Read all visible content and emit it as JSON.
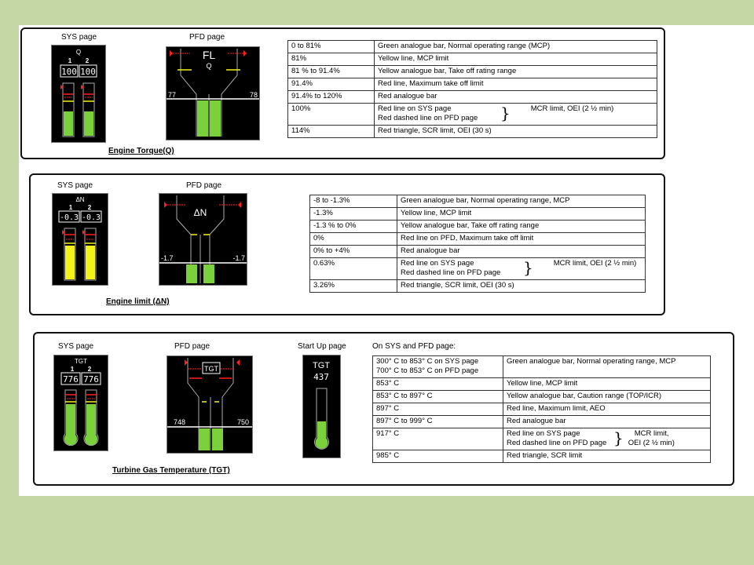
{
  "torque": {
    "sys_label": "SYS page",
    "pfd_label": "PFD page",
    "caption": "Engine Torque(Q)",
    "sys": {
      "title": "Q",
      "eng1": "1",
      "eng2": "2",
      "val1": "100",
      "val2": "100"
    },
    "pfd": {
      "title": "FL",
      "sub": "Q",
      "left_val": "77",
      "right_val": "78"
    },
    "rows": [
      {
        "range": "0 to 81%",
        "desc": "Green analogue bar, Normal operating range (MCP)"
      },
      {
        "range": "81%",
        "desc": "Yellow line, MCP limit"
      },
      {
        "range": "81 % to 91.4%",
        "desc": "Yellow analogue bar, Take off rating range"
      },
      {
        "range": "91.4%",
        "desc": "Red line, Maximum take off limit"
      },
      {
        "range": "91.4% to 120%",
        "desc": "Red analogue bar"
      },
      {
        "range": "100%",
        "desc_a": "Red line on SYS page",
        "desc_b": "Red dashed line on PFD page",
        "brace_note": "MCR limit, OEI (2 ½ min)"
      },
      {
        "range": "114%",
        "desc": "Red triangle, SCR limit, OEI (30 s)"
      }
    ]
  },
  "delta_n": {
    "sys_label": "SYS page",
    "pfd_label": "PFD page",
    "caption": "Engine limit (ΔN)",
    "sys": {
      "title": "ΔN",
      "eng1": "1",
      "eng2": "2",
      "val1": "-0.3",
      "val2": "-0.3"
    },
    "pfd": {
      "title": "ΔN",
      "left_val": "-1.7",
      "right_val": "-1.7"
    },
    "rows": [
      {
        "range": "-8 to -1.3%",
        "desc": "Green analogue bar, Normal operating range, MCP"
      },
      {
        "range": "-1.3%",
        "desc": "Yellow line, MCP limit"
      },
      {
        "range": "-1.3 % to 0%",
        "desc": "Yellow analogue bar, Take off rating range"
      },
      {
        "range": "0%",
        "desc": "Red line on PFD, Maximum take off limit"
      },
      {
        "range": "0% to +4%",
        "desc": "Red analogue bar"
      },
      {
        "range": "0.63%",
        "desc_a": "Red line on SYS page",
        "desc_b": "Red dashed line on PFD page",
        "brace_note": "MCR limit, OEI (2 ½ min)"
      },
      {
        "range": "3.26%",
        "desc": "Red triangle, SCR limit, OEI (30 s)"
      }
    ]
  },
  "tgt": {
    "sys_label": "SYS page",
    "pfd_label": "PFD page",
    "startup_label": "Start Up page",
    "caption": "Turbine Gas Temperature (TGT)",
    "table_heading": "On SYS and PFD page:",
    "sys": {
      "title": "TGT",
      "eng1": "1",
      "eng2": "2",
      "val1": "776",
      "val2": "776"
    },
    "pfd": {
      "title": "TGT",
      "left_val": "748",
      "right_val": "750"
    },
    "startup": {
      "title": "TGT",
      "val": "437"
    },
    "rows": [
      {
        "range_a": "300° C to 853° C on SYS page",
        "range_b": "700° C to 853° C on PFD page",
        "desc": "Green analogue bar, Normal operating range, MCP"
      },
      {
        "range": "853° C",
        "desc": "Yellow line, MCP limit"
      },
      {
        "range": "853° C to 897° C",
        "desc": "Yellow analogue bar, Caution range (TOP/ICR)"
      },
      {
        "range": "897° C",
        "desc": "Red line, Maximum limit, AEO"
      },
      {
        "range": "897° C to 999° C",
        "desc": "Red analogue bar"
      },
      {
        "range": "917° C",
        "desc_a": "Red line on SYS page",
        "desc_b": "Red dashed line on PFD page",
        "brace_note_a": "MCR limit,",
        "brace_note_b": "OEI (2 ½ min)"
      },
      {
        "range": "985° C",
        "desc": "Red triangle, SCR limit"
      }
    ]
  },
  "colors": {
    "green": "#7ad13c",
    "yellow": "#f2f21a",
    "red": "#ff2020",
    "background": "#c4d7a4"
  }
}
